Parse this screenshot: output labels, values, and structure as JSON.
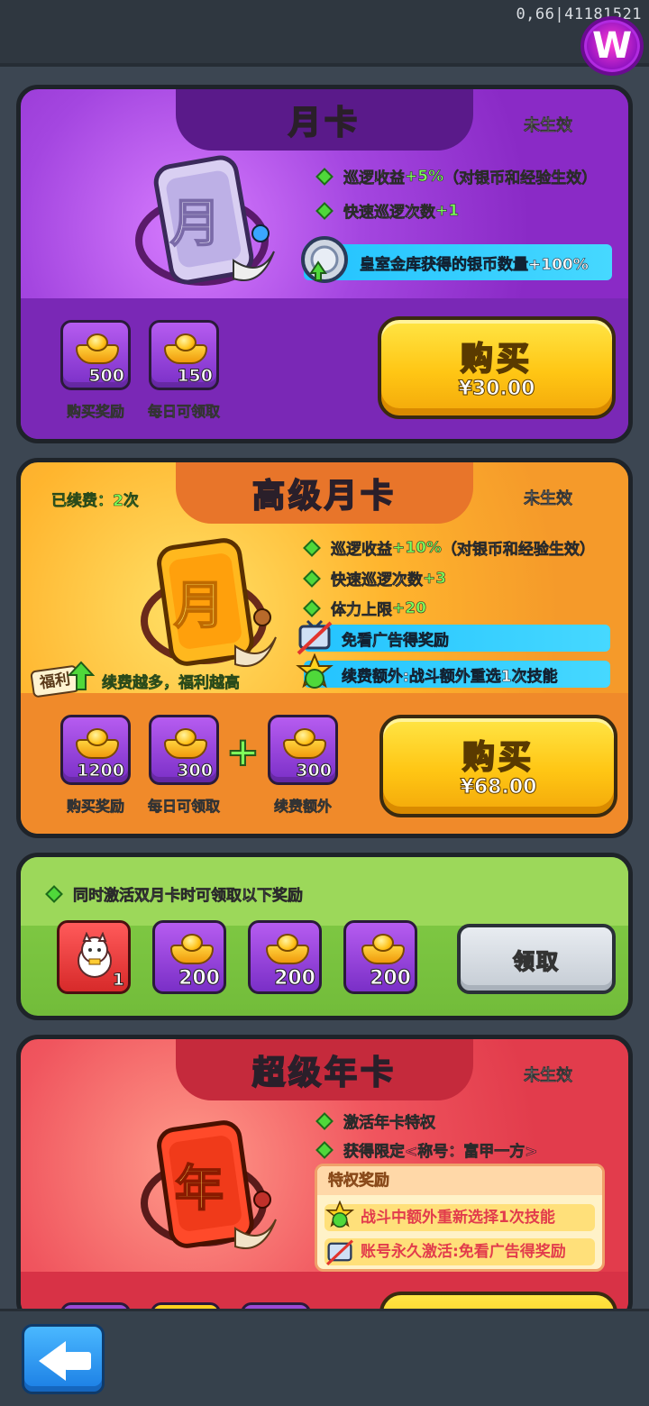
{
  "header": {
    "version_text": "0,66|41181521",
    "logo_letter": "W"
  },
  "monthly_card": {
    "title": "月卡",
    "status": "未生效",
    "icon_char": "月",
    "perks": [
      {
        "text": "巡逻收益",
        "highlight": "+5%",
        "suffix": "（对银币和经验生效）"
      },
      {
        "text": "快速巡逻次数",
        "highlight": "+1",
        "suffix": ""
      }
    ],
    "banner": "皇室金库获得的银币数量+100%",
    "rewards": [
      {
        "count": "500",
        "label": "购买奖励"
      },
      {
        "count": "150",
        "label": "每日可领取"
      }
    ],
    "buy_label": "购买",
    "price": "¥30.00"
  },
  "premium_card": {
    "title": "高级月卡",
    "status": "未生效",
    "renewed": "已续费：2次",
    "icon_char": "月",
    "perks": [
      {
        "text": "巡逻收益",
        "highlight": "+10%",
        "suffix": "（对银币和经验生效）"
      },
      {
        "text": "快速巡逻次数",
        "highlight": "+3",
        "suffix": ""
      },
      {
        "text": "体力上限",
        "highlight": "+20",
        "suffix": ""
      }
    ],
    "banners": [
      "免看广告得奖励",
      "续费额外:战斗额外重选1次技能"
    ],
    "welfare_tag": "福利",
    "welfare_text": "续费越多，福利越高",
    "rewards": [
      {
        "count": "1200",
        "label": "购买奖励"
      },
      {
        "count": "300",
        "label": "每日可领取"
      },
      {
        "count": "300",
        "label": "续费额外"
      }
    ],
    "plus": "+",
    "buy_label": "购买",
    "price": "¥68.00"
  },
  "dual_bonus": {
    "text": "同时激活双月卡时可领取以下奖励",
    "items": [
      {
        "count": "1",
        "type": "cat"
      },
      {
        "count": "200",
        "type": "ingot"
      },
      {
        "count": "200",
        "type": "ingot"
      },
      {
        "count": "200",
        "type": "ingot"
      }
    ],
    "claim_label": "领取"
  },
  "annual_card": {
    "title": "超级年卡",
    "status": "未生效",
    "icon_char": "年",
    "perks": [
      {
        "text": "激活年卡特权",
        "highlight": "",
        "suffix": ""
      },
      {
        "text": "获得限定",
        "highlight": "<称号：富甲一方>",
        "suffix": ""
      }
    ],
    "privilege_title": "特权奖励",
    "privileges": [
      "战斗中额外重新选择1次技能",
      "账号永久激活:免看广告得奖励"
    ]
  },
  "colors": {
    "monthly_bg": "#8e2fc8",
    "premium_bg": "#f0862a",
    "dual_bg": "#7cc442",
    "annual_bg": "#e8444e",
    "buy_button": "#ffc614"
  }
}
